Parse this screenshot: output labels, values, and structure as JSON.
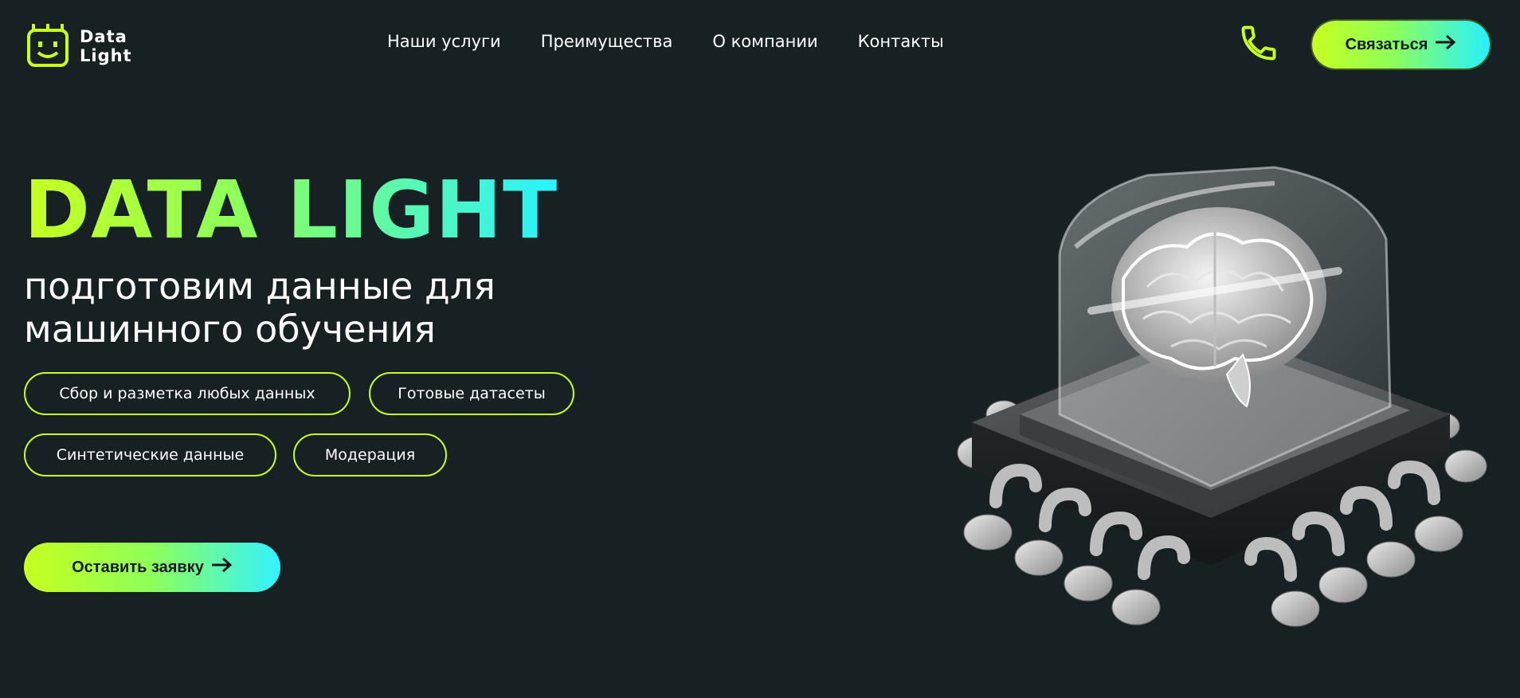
{
  "brand": {
    "name_line1": "Data",
    "name_line2": "Light",
    "logo_icon": "robot-face-icon"
  },
  "nav": {
    "items": [
      {
        "label": "Наши услуги"
      },
      {
        "label": "Преимущества"
      },
      {
        "label": "О компании"
      },
      {
        "label": "Контакты"
      }
    ]
  },
  "header": {
    "phone_icon": "phone-icon",
    "contact_label": "Связаться",
    "contact_arrow": "arrow-right-icon"
  },
  "hero": {
    "title": "DATA LIGHT",
    "subtitle": "подготовим данные для машинного обучения",
    "tags": [
      {
        "label": "Сбор и разметка любых данных"
      },
      {
        "label": "Готовые датасеты"
      },
      {
        "label": "Синтетические данные"
      },
      {
        "label": "Модерация"
      }
    ],
    "cta_label": "Оставить заявку",
    "illustration": "brain-chip-illustration"
  },
  "colors": {
    "background": "#172124",
    "accent_lime": "#c7ff1f",
    "accent_cyan": "#29f2ff",
    "text": "#ffffff"
  }
}
